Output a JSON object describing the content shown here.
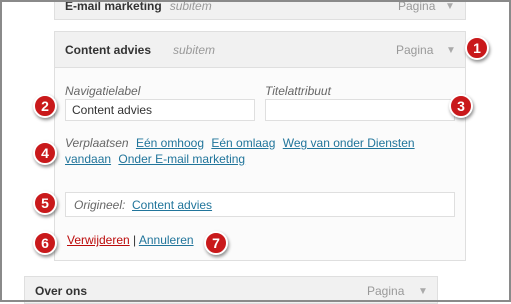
{
  "items": {
    "email_marketing": {
      "title": "E-mail marketing",
      "subitem": "subitem",
      "type": "Pagina"
    },
    "content_advies": {
      "title": "Content advies",
      "subitem": "subitem",
      "type": "Pagina"
    },
    "over_ons": {
      "title": "Over ons",
      "type": "Pagina"
    }
  },
  "form": {
    "nav_label": "Navigatielabel",
    "nav_value": "Content advies",
    "title_attr_label": "Titelattribuut",
    "title_attr_value": "",
    "move_label": "Verplaatsen",
    "move_up": "Eén omhoog",
    "move_down": "Eén omlaag",
    "move_out_line1": "Weg van onder Diensten",
    "move_out_line2": "vandaan",
    "move_under": "Onder E-mail marketing",
    "original_label": "Origineel:",
    "original_link": "Content advies",
    "remove": "Verwijderen",
    "separator": "|",
    "cancel": "Annuleren"
  },
  "badges": [
    "1",
    "2",
    "3",
    "4",
    "5",
    "6",
    "7"
  ],
  "colors": {
    "badge": "#c9191b",
    "link": "#21759b",
    "remove": "#bc0b0b"
  }
}
